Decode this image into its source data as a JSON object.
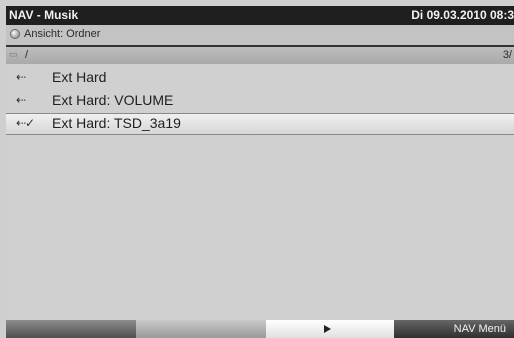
{
  "titlebar": {
    "title": "NAV - Musik",
    "datetime": "Di 09.03.2010 08:3"
  },
  "viewbar": {
    "label": "Ansicht: Ordner",
    "icon": "disc-icon"
  },
  "pathbar": {
    "path": "/",
    "count": "3/",
    "icon": "folder-up-icon"
  },
  "list": {
    "items": [
      {
        "label": "Ext Hard",
        "icon": "usb-icon",
        "glyph": "⇠",
        "selected": false
      },
      {
        "label": "Ext Hard: VOLUME",
        "icon": "usb-icon",
        "glyph": "⇠",
        "selected": false
      },
      {
        "label": "Ext Hard: TSD_3a19",
        "icon": "usb-check-icon",
        "glyph": "⇠✓",
        "selected": true
      }
    ]
  },
  "bottombar": {
    "play_icon": "play-icon",
    "menu_label": "NAV Menü"
  },
  "colors": {
    "titlebar": "#1f1f1f",
    "background": "#d0d0d0",
    "selection": "#e6e6e6"
  }
}
